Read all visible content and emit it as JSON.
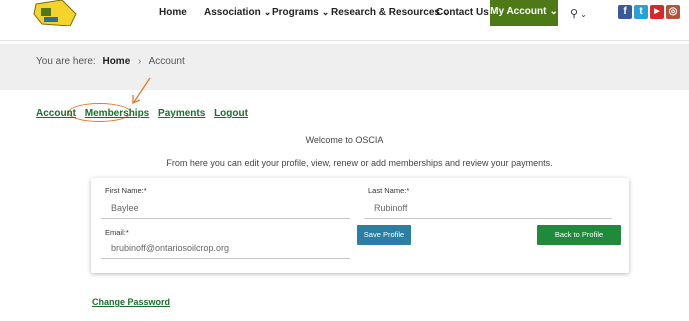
{
  "header": {
    "nav": {
      "home": "Home",
      "association": "Association",
      "programs": "Programs",
      "research": "Research & Resources",
      "contact": "Contact Us",
      "my_account": "My Account"
    },
    "chevron": "⌄",
    "search_icon": "⚲",
    "social": {
      "facebook": "f",
      "twitter": "t",
      "youtube": "▶",
      "instagram": "◎"
    },
    "colors": {
      "my_account_bg": "#4d7a16",
      "facebook": "#3b5998",
      "twitter": "#2a9fd8",
      "youtube": "#d42a2a",
      "instagram": "#b3543a"
    }
  },
  "breadcrumb": {
    "prefix": "You are here:",
    "home": "Home",
    "separator": "›",
    "current": "Account"
  },
  "account_tabs": {
    "account": "Account",
    "memberships": "Memberships",
    "payments": "Payments",
    "logout": "Logout"
  },
  "welcome": "Welcome to OSCIA",
  "intro": "From here you can edit your profile, view, renew or add memberships and review your payments.",
  "profile": {
    "first_name_label": "First Name:*",
    "first_name_value": "Baylee",
    "last_name_label": "Last Name:*",
    "last_name_value": "Rubinoff",
    "email_label": "Email:*",
    "email_value": "brubinoff@ontariosoilcrop.org",
    "save_label": "Save Profile",
    "back_label": "Back to Profile"
  },
  "change_password": "Change Password"
}
